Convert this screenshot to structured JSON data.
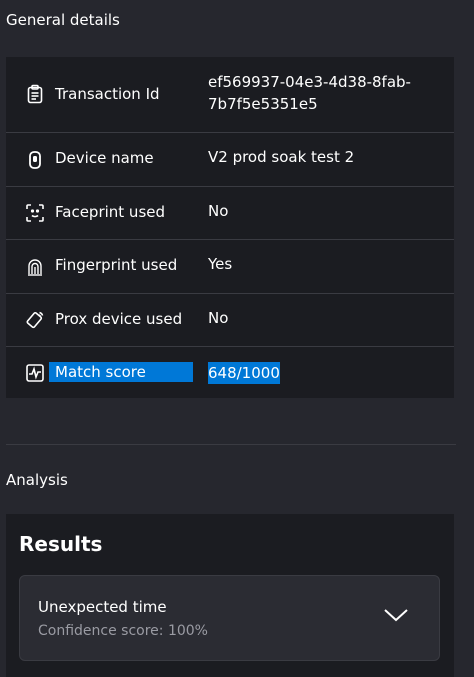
{
  "general": {
    "title": "General details",
    "rows": [
      {
        "icon": "clipboard-icon",
        "label": "Transaction Id",
        "value_line1": "ef569937-04e3-4d38-8fab-",
        "value_line2": "7b7f5e5351e5"
      },
      {
        "icon": "device-icon",
        "label": "Device name",
        "value": "V2 prod soak test 2"
      },
      {
        "icon": "face-scan-icon",
        "label": "Faceprint used",
        "value": "No"
      },
      {
        "icon": "fingerprint-icon",
        "label": "Fingerprint used",
        "value": "Yes"
      },
      {
        "icon": "prox-card-icon",
        "label": "Prox device used",
        "value": "No"
      },
      {
        "icon": "activity-chart-icon",
        "label": "Match score",
        "value": "648/1000"
      }
    ]
  },
  "analysis": {
    "title": "Analysis",
    "results_title": "Results",
    "items": [
      {
        "name": "Unexpected time",
        "confidence": "Confidence score: 100%",
        "icon": "chevron-down-icon"
      }
    ]
  },
  "colors": {
    "background": "#26272e",
    "panel": "#1b1c21",
    "highlight": "#0078d7",
    "muted_text": "#9a9ba3"
  }
}
